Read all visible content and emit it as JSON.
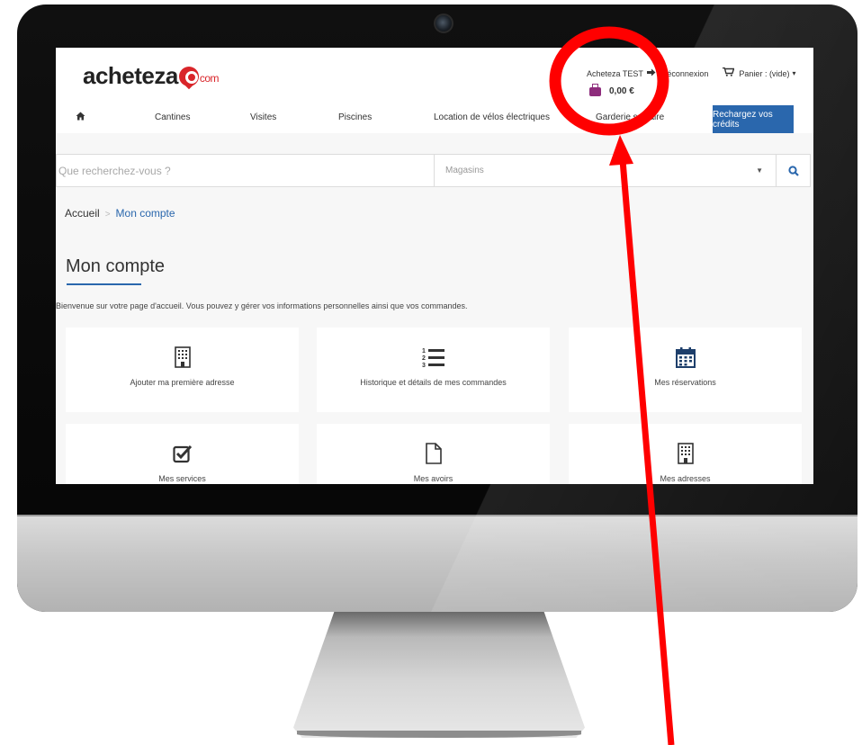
{
  "site": {
    "logo_main": "acheteza",
    "logo_suffix": "com"
  },
  "header": {
    "user_name": "Acheteza TEST",
    "logout_label": "Déconnexion",
    "cart_label": "Panier : (vide)",
    "wallet_amount": "0,00 €"
  },
  "nav": {
    "items": [
      "Cantines",
      "Visites",
      "Piscines",
      "Location de vélos électriques",
      "Garderie scolaire"
    ],
    "cta": "Rechargez vos crédits"
  },
  "search": {
    "placeholder": "Que recherchez-vous ?",
    "store_select": "Magasins"
  },
  "breadcrumb": {
    "home": "Accueil",
    "current": "Mon compte"
  },
  "page": {
    "title": "Mon compte",
    "welcome": "Bienvenue sur votre page d'accueil. Vous pouvez y gérer vos informations personnelles ainsi que vos commandes."
  },
  "cards": [
    {
      "label": "Ajouter ma première adresse",
      "icon": "building-icon"
    },
    {
      "label": "Historique et détails de mes commandes",
      "icon": "ordered-list-icon"
    },
    {
      "label": "Mes réservations",
      "icon": "calendar-icon"
    },
    {
      "label": "Mes services",
      "icon": "checkbox-icon"
    },
    {
      "label": "Mes avoirs",
      "icon": "document-icon"
    },
    {
      "label": "Mes adresses",
      "icon": "building-icon"
    }
  ],
  "colors": {
    "brand_blue": "#2a67ad",
    "brand_red": "#d9252a",
    "wallet_purple": "#8e2c7c",
    "annotation_red": "#ff0000"
  }
}
